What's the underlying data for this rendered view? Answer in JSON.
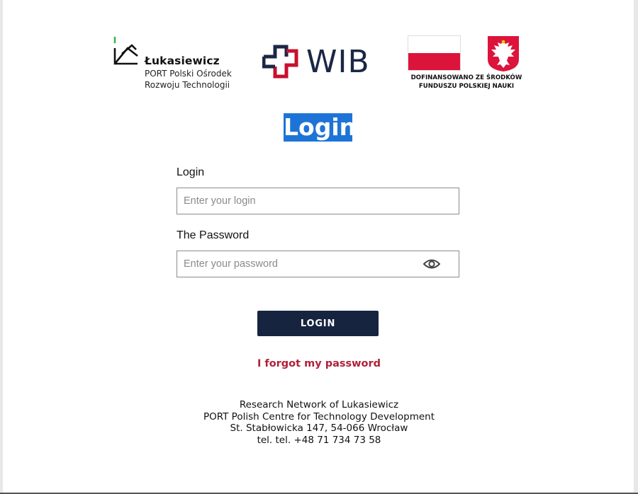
{
  "logos": {
    "lukasiewicz": {
      "name": "Łukasiewicz",
      "subtitle_line1": "PORT Polski Ośrodek",
      "subtitle_line2": "Rozwoju Technologii",
      "accent": "#3bb54a"
    },
    "wib": {
      "text": "WIB",
      "icon_color": "#c8102e",
      "text_color": "#1b2745"
    },
    "funding": {
      "line1": "DOFINANSOWANO ZE ŚRODKÓW",
      "line2": "FUNDUSZU POLSKIEJ NAUKI",
      "flag_colors": [
        "#ffffff",
        "#dc143c"
      ]
    }
  },
  "page": {
    "title": "Login",
    "title_bg": "#1e74d6"
  },
  "form": {
    "login_label": "Login",
    "login_placeholder": "Enter your login",
    "login_value": "",
    "password_label": "The Password",
    "password_placeholder": "Enter your password",
    "password_value": "",
    "password_toggle_icon": "eye-icon",
    "submit_label": "LOGIN",
    "submit_color": "#172440",
    "forgot_label": "I forgot my password",
    "forgot_color": "#b0213a"
  },
  "footer": {
    "line1": "Research Network of Lukasiewicz",
    "line2": "PORT Polish Centre for Technology Development",
    "line3": "St. Stabłowicka 147, 54-066 Wrocław",
    "line4": "tel. tel. +48 71 734 73 58"
  }
}
